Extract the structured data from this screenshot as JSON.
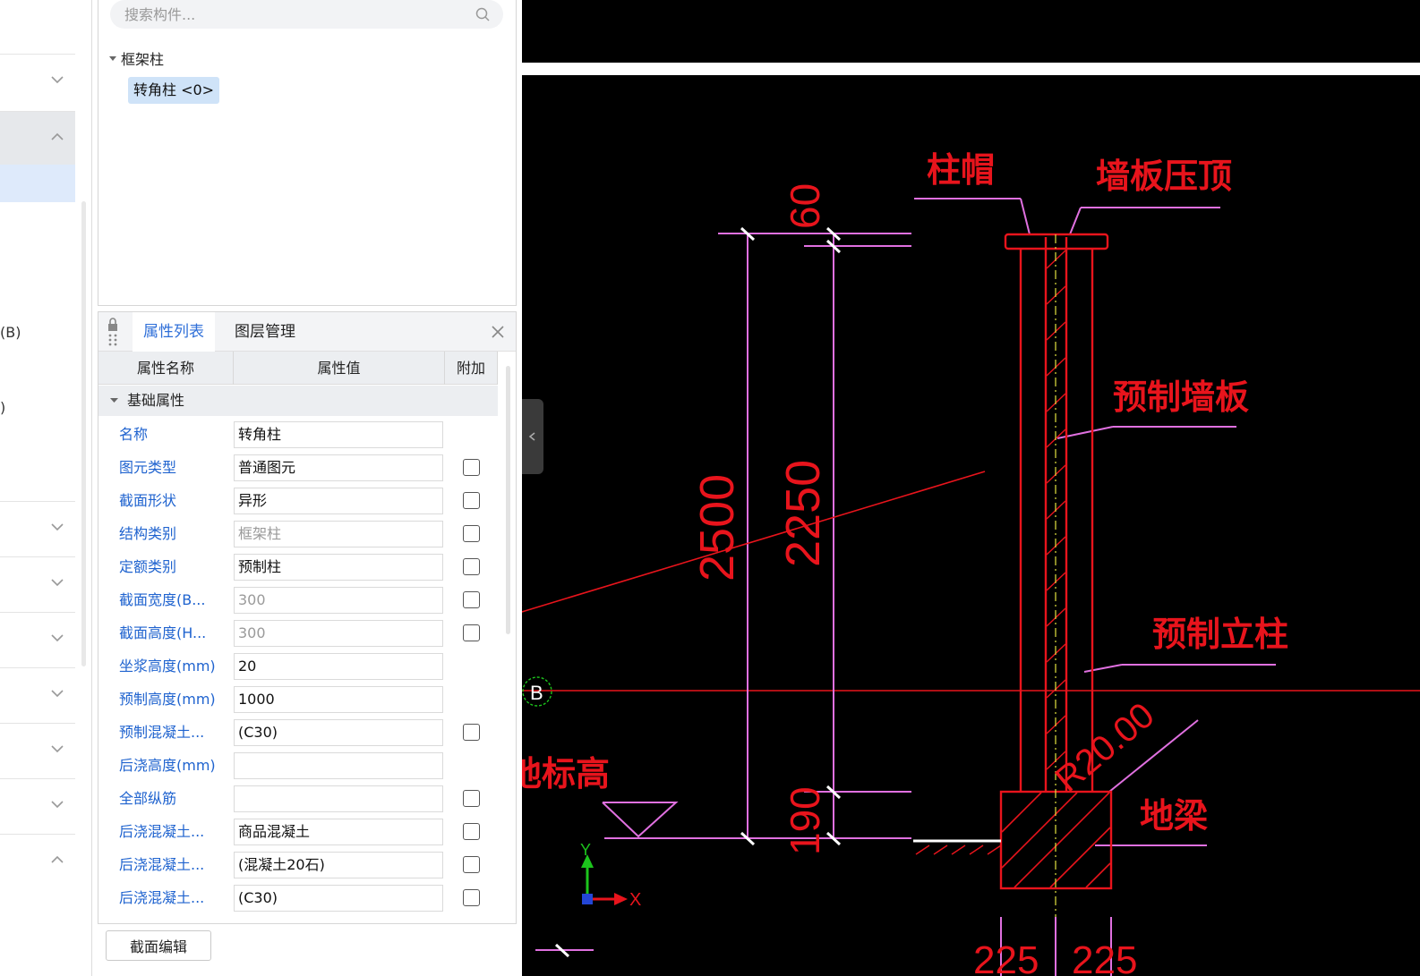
{
  "left_nav": {
    "label_b": "(B)",
    "label_paren": ")"
  },
  "component_panel": {
    "search_placeholder": "搜索构件...",
    "tree_root": "框架柱",
    "tree_item": "转角柱 <0>"
  },
  "property_panel": {
    "tabs": [
      "属性列表",
      "图层管理"
    ],
    "columns": [
      "属性名称",
      "属性值",
      "附加"
    ],
    "group": "基础属性",
    "rows": [
      {
        "name": "名称",
        "value": "转角柱",
        "dim": false,
        "checkbox": false
      },
      {
        "name": "图元类型",
        "value": "普通图元",
        "dim": false,
        "checkbox": true
      },
      {
        "name": "截面形状",
        "value": "异形",
        "dim": false,
        "checkbox": true
      },
      {
        "name": "结构类别",
        "value": "框架柱",
        "dim": true,
        "checkbox": true
      },
      {
        "name": "定额类别",
        "value": "预制柱",
        "dim": false,
        "checkbox": true
      },
      {
        "name": "截面宽度(B...",
        "value": "300",
        "dim": true,
        "checkbox": true
      },
      {
        "name": "截面高度(H...",
        "value": "300",
        "dim": true,
        "checkbox": true
      },
      {
        "name": "坐浆高度(mm)",
        "value": "20",
        "dim": false,
        "checkbox": false
      },
      {
        "name": "预制高度(mm)",
        "value": "1000",
        "dim": false,
        "checkbox": false
      },
      {
        "name": "预制混凝土...",
        "value": "(C30)",
        "dim": false,
        "checkbox": true
      },
      {
        "name": "后浇高度(mm)",
        "value": "",
        "dim": false,
        "checkbox": false
      },
      {
        "name": "全部纵筋",
        "value": "",
        "dim": false,
        "checkbox": true
      },
      {
        "name": "后浇混凝土...",
        "value": "商品混凝土",
        "dim": false,
        "checkbox": true
      },
      {
        "name": "后浇混凝土...",
        "value": "(混凝土20石)",
        "dim": false,
        "checkbox": true
      },
      {
        "name": "后浇混凝土...",
        "value": "(C30)",
        "dim": false,
        "checkbox": true
      }
    ],
    "edit_button": "截面编辑"
  },
  "cad": {
    "labels": {
      "column_cap": "柱帽",
      "wall_top": "墙板压顶",
      "precast_wall": "预制墙板",
      "precast_column": "预制立柱",
      "ground_beam": "地梁",
      "ground_level": "地标高",
      "axis_b": "B",
      "radius": "R20.00",
      "axis_x": "X",
      "axis_y": "Y"
    },
    "dimensions": {
      "total": "2500",
      "top": "60",
      "middle": "2250",
      "bottom": "190",
      "base_left": "225",
      "base_right": "225"
    },
    "colors": {
      "annotation": "#e8141c",
      "dimension": "#e070e0",
      "background": "#000000"
    }
  }
}
